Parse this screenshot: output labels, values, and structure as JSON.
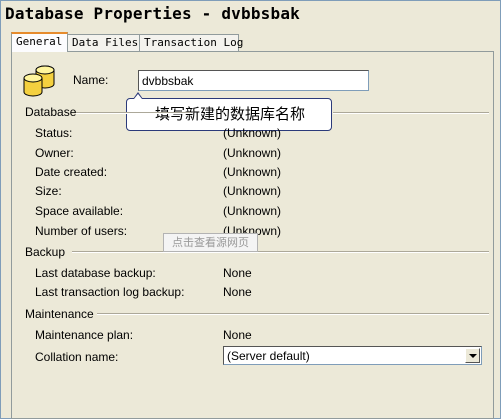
{
  "window": {
    "title": "Database Properties - dvbbsbak"
  },
  "tabs": [
    {
      "label": "General",
      "active": true
    },
    {
      "label": "Data Files",
      "active": false
    },
    {
      "label": "Transaction Log",
      "active": false
    }
  ],
  "name": {
    "label": "Name:",
    "value": "dvbbsbak"
  },
  "callout": {
    "text": "填写新建的数据库名称"
  },
  "database": {
    "title": "Database",
    "rows": [
      {
        "label": "Status:",
        "value": "(Unknown)"
      },
      {
        "label": "Owner:",
        "value": "(Unknown)"
      },
      {
        "label": "Date created:",
        "value": "(Unknown)"
      },
      {
        "label": "Size:",
        "value": "(Unknown)"
      },
      {
        "label": "Space available:",
        "value": "(Unknown)"
      },
      {
        "label": "Number of users:",
        "value": "(Unknown)"
      }
    ]
  },
  "watermark": {
    "text": "点击查看源网页"
  },
  "backup": {
    "title": "Backup",
    "rows": [
      {
        "label": "Last database backup:",
        "value": "None"
      },
      {
        "label": "Last transaction log backup:",
        "value": "None"
      }
    ]
  },
  "maintenance": {
    "title": "Maintenance",
    "plan": {
      "label": "Maintenance plan:",
      "value": "None"
    },
    "collation": {
      "label": "Collation name:",
      "value": "(Server default)"
    }
  }
}
